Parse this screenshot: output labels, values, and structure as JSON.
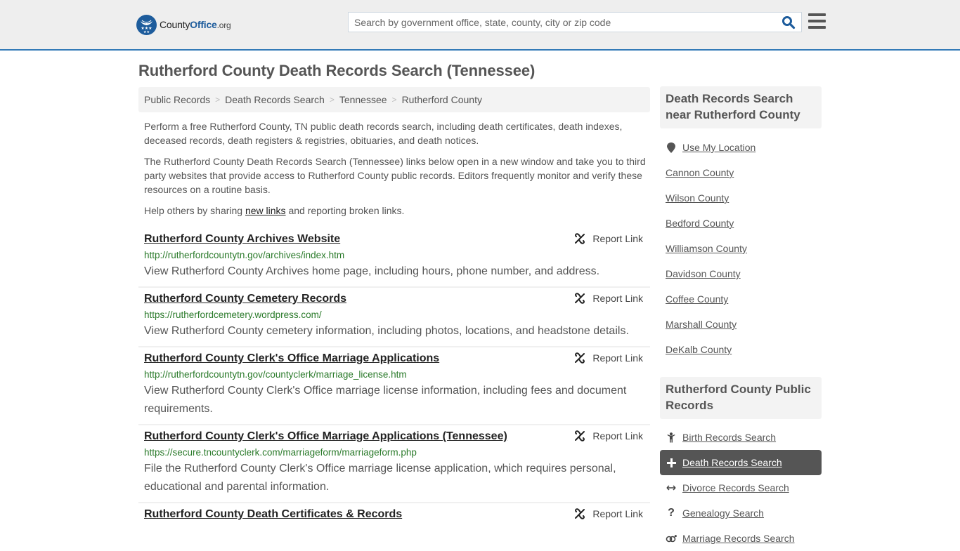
{
  "header": {
    "logo": {
      "county": "County",
      "office": "Office",
      "org": ".org"
    },
    "search": {
      "placeholder": "Search by government office, state, county, city or zip code",
      "value": ""
    }
  },
  "page": {
    "title": "Rutherford County Death Records Search (Tennessee)",
    "breadcrumb": [
      "Public Records",
      "Death Records Search",
      "Tennessee",
      "Rutherford County"
    ],
    "intro": {
      "p1": "Perform a free Rutherford County, TN public death records search, including death certificates, death indexes, deceased records, death registers & registries, obituaries, and death notices.",
      "p2": "The Rutherford County Death Records Search (Tennessee) links below open in a new window and take you to third party websites that provide access to Rutherford County public records. Editors frequently monitor and verify these resources on a routine basis.",
      "p3_before": "Help others by sharing ",
      "p3_link": "new links",
      "p3_after": " and reporting broken links."
    },
    "report_label": "Report Link",
    "results": [
      {
        "title": "Rutherford County Archives Website",
        "url": "http://rutherfordcountytn.gov/archives/index.htm",
        "desc": "View Rutherford County Archives home page, including hours, phone number, and address."
      },
      {
        "title": "Rutherford County Cemetery Records",
        "url": "https://rutherfordcemetery.wordpress.com/",
        "desc": "View Rutherford County cemetery information, including photos, locations, and headstone details."
      },
      {
        "title": "Rutherford County Clerk's Office Marriage Applications",
        "url": "http://rutherfordcountytn.gov/countyclerk/marriage_license.htm",
        "desc": "View Rutherford County Clerk's Office marriage license information, including fees and document requirements."
      },
      {
        "title": "Rutherford County Clerk's Office Marriage Applications (Tennessee)",
        "url": "https://secure.tncountyclerk.com/marriageform/marriageform.php",
        "desc": "File the Rutherford County Clerk's Office marriage license application, which requires personal, educational and parental information."
      },
      {
        "title": "Rutherford County Death Certificates & Records",
        "url": "",
        "desc": ""
      }
    ]
  },
  "sidebar": {
    "nearby": {
      "heading": "Death Records Search near Rutherford County",
      "use_location": "Use My Location",
      "counties": [
        "Cannon County",
        "Wilson County",
        "Bedford County",
        "Williamson County",
        "Davidson County",
        "Coffee County",
        "Marshall County",
        "DeKalb County"
      ]
    },
    "public_records": {
      "heading": "Rutherford County Public Records",
      "items": [
        {
          "label": "Birth Records Search",
          "icon": "child-icon",
          "active": false
        },
        {
          "label": "Death Records Search",
          "icon": "plus-icon",
          "active": true
        },
        {
          "label": "Divorce Records Search",
          "icon": "arrows-horizontal-icon",
          "active": false
        },
        {
          "label": "Genealogy Search",
          "icon": "question-icon",
          "active": false
        },
        {
          "label": "Marriage Records Search",
          "icon": "gender-icon",
          "active": false
        }
      ]
    }
  },
  "colors": {
    "accent": "#337ab7",
    "brand": "#1d5c9c",
    "url_green": "#2a7a2a",
    "active_bg": "#555555"
  }
}
